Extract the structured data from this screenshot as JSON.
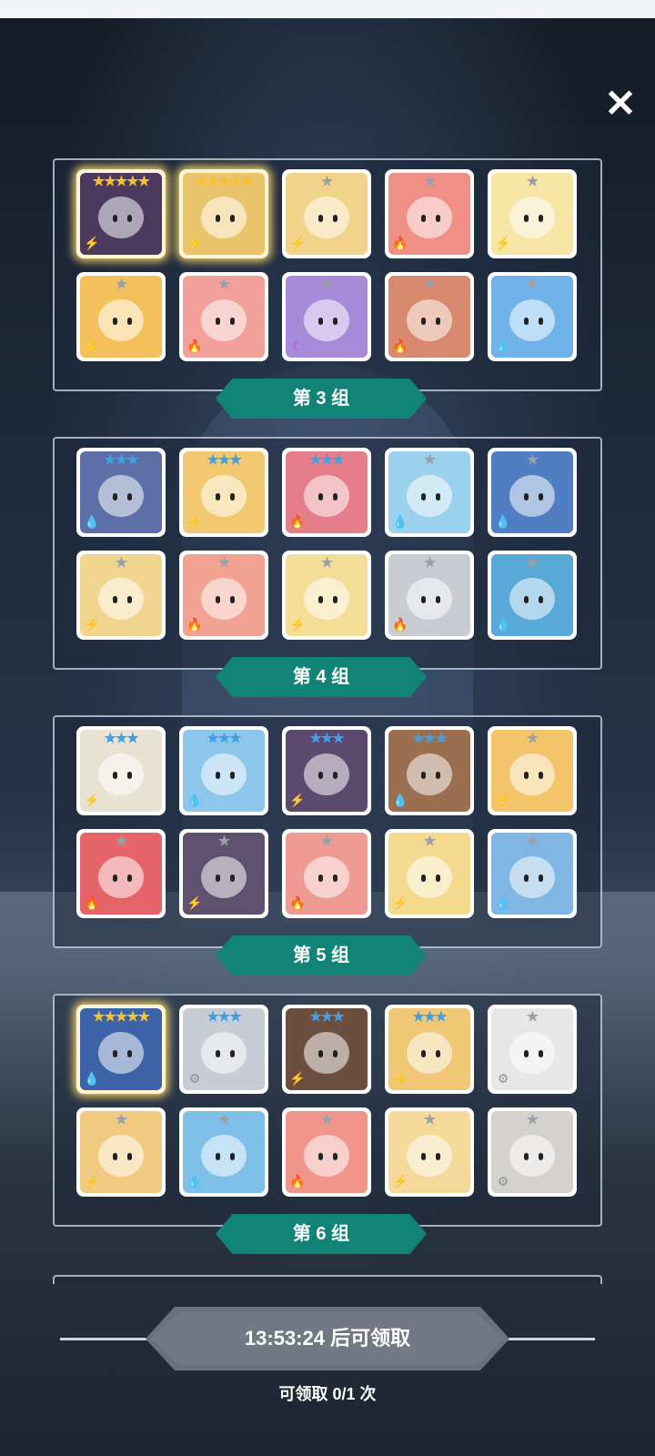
{
  "close_label": "✕",
  "groups": [
    {
      "label": "第 3 组",
      "heroes": [
        {
          "stars": "★★★★★",
          "star_color": "gold",
          "element": "⚡",
          "element_color": "#f2a81d",
          "art": "#4b3a5e",
          "gold": true
        },
        {
          "stars": "★★★★★",
          "star_color": "gold",
          "element": "⚡",
          "element_color": "#f2a81d",
          "art": "#e9c46a",
          "gold": true
        },
        {
          "stars": "★",
          "star_color": "gray",
          "element": "⚡",
          "element_color": "#f2a81d",
          "art": "#f1d38a",
          "gold": false
        },
        {
          "stars": "★",
          "star_color": "gray",
          "element": "🔥",
          "element_color": "#e0492f",
          "art": "#f08f86",
          "gold": false
        },
        {
          "stars": "★",
          "star_color": "gray",
          "element": "⚡",
          "element_color": "#f2a81d",
          "art": "#f7e5a6",
          "gold": false
        },
        {
          "stars": "★",
          "star_color": "gray",
          "element": "⚡",
          "element_color": "#f2a81d",
          "art": "#f3c05b",
          "gold": false
        },
        {
          "stars": "★",
          "star_color": "gray",
          "element": "🔥",
          "element_color": "#e0492f",
          "art": "#f3a09a",
          "gold": false
        },
        {
          "stars": "★",
          "star_color": "gray",
          "element": "☾",
          "element_color": "#b44fd1",
          "art": "#a78bd9",
          "gold": false
        },
        {
          "stars": "★",
          "star_color": "gray",
          "element": "🔥",
          "element_color": "#e0492f",
          "art": "#d98a6e",
          "gold": false
        },
        {
          "stars": "★",
          "star_color": "gray",
          "element": "💧",
          "element_color": "#2b7fd6",
          "art": "#6fb3ea",
          "gold": false
        }
      ]
    },
    {
      "label": "第 4 组",
      "heroes": [
        {
          "stars": "★★★",
          "star_color": "blue",
          "element": "💧",
          "element_color": "#2b7fd6",
          "art": "#5c6fa6",
          "gold": false
        },
        {
          "stars": "★★★",
          "star_color": "blue",
          "element": "⚡",
          "element_color": "#f2a81d",
          "art": "#f2c970",
          "gold": false
        },
        {
          "stars": "★★★",
          "star_color": "blue",
          "element": "🔥",
          "element_color": "#e0492f",
          "art": "#e57d8a",
          "gold": false
        },
        {
          "stars": "★",
          "star_color": "gray",
          "element": "💧",
          "element_color": "#2b7fd6",
          "art": "#9ad1ec",
          "gold": false
        },
        {
          "stars": "★",
          "star_color": "gray",
          "element": "💧",
          "element_color": "#2b7fd6",
          "art": "#4f7ec2",
          "gold": false
        },
        {
          "stars": "★",
          "star_color": "gray",
          "element": "⚡",
          "element_color": "#f2a81d",
          "art": "#f1d58e",
          "gold": false
        },
        {
          "stars": "★",
          "star_color": "gray",
          "element": "🔥",
          "element_color": "#e0492f",
          "art": "#f2a292",
          "gold": false
        },
        {
          "stars": "★",
          "star_color": "gray",
          "element": "⚡",
          "element_color": "#f2a81d",
          "art": "#f4dd97",
          "gold": false
        },
        {
          "stars": "★",
          "star_color": "gray",
          "element": "🔥",
          "element_color": "#e0492f",
          "art": "#c9ccd3",
          "gold": false
        },
        {
          "stars": "★",
          "star_color": "gray",
          "element": "💧",
          "element_color": "#2b7fd6",
          "art": "#58a9d8",
          "gold": false
        }
      ]
    },
    {
      "label": "第 5 组",
      "heroes": [
        {
          "stars": "★★★",
          "star_color": "blue",
          "element": "⚡",
          "element_color": "#f2a81d",
          "art": "#e8e2d2",
          "gold": false
        },
        {
          "stars": "★★★",
          "star_color": "blue",
          "element": "💧",
          "element_color": "#2b7fd6",
          "art": "#8cc6ea",
          "gold": false
        },
        {
          "stars": "★★★",
          "star_color": "blue",
          "element": "⚡",
          "element_color": "#f2a81d",
          "art": "#5b4a6e",
          "gold": false
        },
        {
          "stars": "★★★",
          "star_color": "blue",
          "element": "💧",
          "element_color": "#2b7fd6",
          "art": "#9a6e4e",
          "gold": false
        },
        {
          "stars": "★",
          "star_color": "gray",
          "element": "⚡",
          "element_color": "#f2a81d",
          "art": "#f3c46a",
          "gold": false
        },
        {
          "stars": "★",
          "star_color": "gray",
          "element": "🔥",
          "element_color": "#e0492f",
          "art": "#e5646a",
          "gold": false
        },
        {
          "stars": "★",
          "star_color": "gray",
          "element": "⚡",
          "element_color": "#f2a81d",
          "art": "#5f5170",
          "gold": false
        },
        {
          "stars": "★",
          "star_color": "gray",
          "element": "🔥",
          "element_color": "#e0492f",
          "art": "#ef9a92",
          "gold": false
        },
        {
          "stars": "★",
          "star_color": "gray",
          "element": "⚡",
          "element_color": "#f2a81d",
          "art": "#f3da8f",
          "gold": false
        },
        {
          "stars": "★",
          "star_color": "gray",
          "element": "💧",
          "element_color": "#2b7fd6",
          "art": "#7fb6e3",
          "gold": false
        }
      ]
    },
    {
      "label": "第 6 组",
      "heroes": [
        {
          "stars": "★★★★★",
          "star_color": "gold",
          "element": "💧",
          "element_color": "#2b7fd6",
          "art": "#3c63a8",
          "gold": true
        },
        {
          "stars": "★★★",
          "star_color": "blue",
          "element": "⚙",
          "element_color": "#8a8f99",
          "art": "#c8ccd4",
          "gold": false
        },
        {
          "stars": "★★★",
          "star_color": "blue",
          "element": "⚡",
          "element_color": "#f2a81d",
          "art": "#6b4e3d",
          "gold": false
        },
        {
          "stars": "★★★",
          "star_color": "blue",
          "element": "⚡",
          "element_color": "#f2a81d",
          "art": "#f0c775",
          "gold": false
        },
        {
          "stars": "★",
          "star_color": "gray",
          "element": "⚙",
          "element_color": "#8a8f99",
          "art": "#e7e7e7",
          "gold": false
        },
        {
          "stars": "★",
          "star_color": "gray",
          "element": "⚡",
          "element_color": "#f2a81d",
          "art": "#f2c981",
          "gold": false
        },
        {
          "stars": "★",
          "star_color": "gray",
          "element": "💧",
          "element_color": "#2b7fd6",
          "art": "#7fc0e8",
          "gold": false
        },
        {
          "stars": "★",
          "star_color": "gray",
          "element": "🔥",
          "element_color": "#e0492f",
          "art": "#f0958c",
          "gold": false
        },
        {
          "stars": "★",
          "star_color": "gray",
          "element": "⚡",
          "element_color": "#f2a81d",
          "art": "#f4d99a",
          "gold": false
        },
        {
          "stars": "★",
          "star_color": "gray",
          "element": "⚙",
          "element_color": "#8a8f99",
          "art": "#d4d2cf",
          "gold": false
        }
      ]
    }
  ],
  "claim": {
    "timer_label": "13:53:24 后可领取",
    "count_label": "可领取 0/1 次"
  }
}
